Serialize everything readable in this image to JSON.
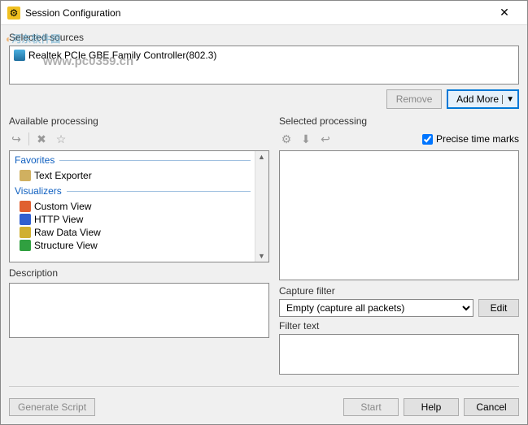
{
  "window": {
    "title": "Session Configuration"
  },
  "watermark": {
    "brand_cn": "河东软件园",
    "url": "www.pc0359.cn"
  },
  "sources": {
    "label": "Selected sources",
    "items": [
      {
        "name": "Realtek PCIe GBE Family Controller(802.3)"
      }
    ],
    "remove": "Remove",
    "add_more": "Add More"
  },
  "available": {
    "label": "Available processing",
    "groups": [
      {
        "name": "Favorites",
        "items": [
          {
            "name": "Text Exporter",
            "color": "#d0b060"
          }
        ]
      },
      {
        "name": "Visualizers",
        "items": [
          {
            "name": "Custom View",
            "color": "#e06030"
          },
          {
            "name": "HTTP View",
            "color": "#3060d0"
          },
          {
            "name": "Raw Data View",
            "color": "#d0b030"
          },
          {
            "name": "Structure View",
            "color": "#30a040"
          }
        ]
      }
    ]
  },
  "selected": {
    "label": "Selected processing",
    "precise_label": "Precise time marks",
    "precise_checked": true
  },
  "description": {
    "label": "Description"
  },
  "capture": {
    "label": "Capture filter",
    "selected": "Empty (capture all packets)",
    "edit": "Edit",
    "filter_text_label": "Filter text"
  },
  "footer": {
    "generate": "Generate Script",
    "start": "Start",
    "help": "Help",
    "cancel": "Cancel"
  }
}
